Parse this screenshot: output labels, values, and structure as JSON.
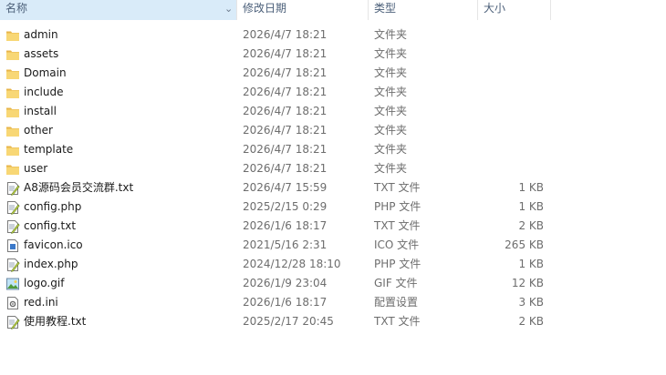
{
  "columns": {
    "name": "名称",
    "date": "修改日期",
    "type": "类型",
    "size": "大小"
  },
  "files": [
    {
      "name": "admin",
      "date": "2026/4/7 18:21",
      "type": "文件夹",
      "size": "",
      "icon": "folder-icon"
    },
    {
      "name": "assets",
      "date": "2026/4/7 18:21",
      "type": "文件夹",
      "size": "",
      "icon": "folder-icon"
    },
    {
      "name": "Domain",
      "date": "2026/4/7 18:21",
      "type": "文件夹",
      "size": "",
      "icon": "folder-icon"
    },
    {
      "name": "include",
      "date": "2026/4/7 18:21",
      "type": "文件夹",
      "size": "",
      "icon": "folder-icon"
    },
    {
      "name": "install",
      "date": "2026/4/7 18:21",
      "type": "文件夹",
      "size": "",
      "icon": "folder-icon"
    },
    {
      "name": "other",
      "date": "2026/4/7 18:21",
      "type": "文件夹",
      "size": "",
      "icon": "folder-icon"
    },
    {
      "name": "template",
      "date": "2026/4/7 18:21",
      "type": "文件夹",
      "size": "",
      "icon": "folder-icon"
    },
    {
      "name": "user",
      "date": "2026/4/7 18:21",
      "type": "文件夹",
      "size": "",
      "icon": "folder-icon"
    },
    {
      "name": "A8源码会员交流群.txt",
      "date": "2026/4/7 15:59",
      "type": "TXT 文件",
      "size": "1 KB",
      "icon": "text-file-icon"
    },
    {
      "name": "config.php",
      "date": "2025/2/15 0:29",
      "type": "PHP 文件",
      "size": "1 KB",
      "icon": "text-file-icon"
    },
    {
      "name": "config.txt",
      "date": "2026/1/6 18:17",
      "type": "TXT 文件",
      "size": "2 KB",
      "icon": "text-file-icon"
    },
    {
      "name": "favicon.ico",
      "date": "2021/5/16 2:31",
      "type": "ICO 文件",
      "size": "265 KB",
      "icon": "ico-file-icon"
    },
    {
      "name": "index.php",
      "date": "2024/12/28 18:10",
      "type": "PHP 文件",
      "size": "1 KB",
      "icon": "text-file-icon"
    },
    {
      "name": "logo.gif",
      "date": "2026/1/9 23:04",
      "type": "GIF 文件",
      "size": "12 KB",
      "icon": "image-file-icon"
    },
    {
      "name": "red.ini",
      "date": "2026/1/6 18:17",
      "type": "配置设置",
      "size": "3 KB",
      "icon": "ini-file-icon"
    },
    {
      "name": "使用教程.txt",
      "date": "2025/2/17 20:45",
      "type": "TXT 文件",
      "size": "2 KB",
      "icon": "text-file-icon"
    }
  ]
}
